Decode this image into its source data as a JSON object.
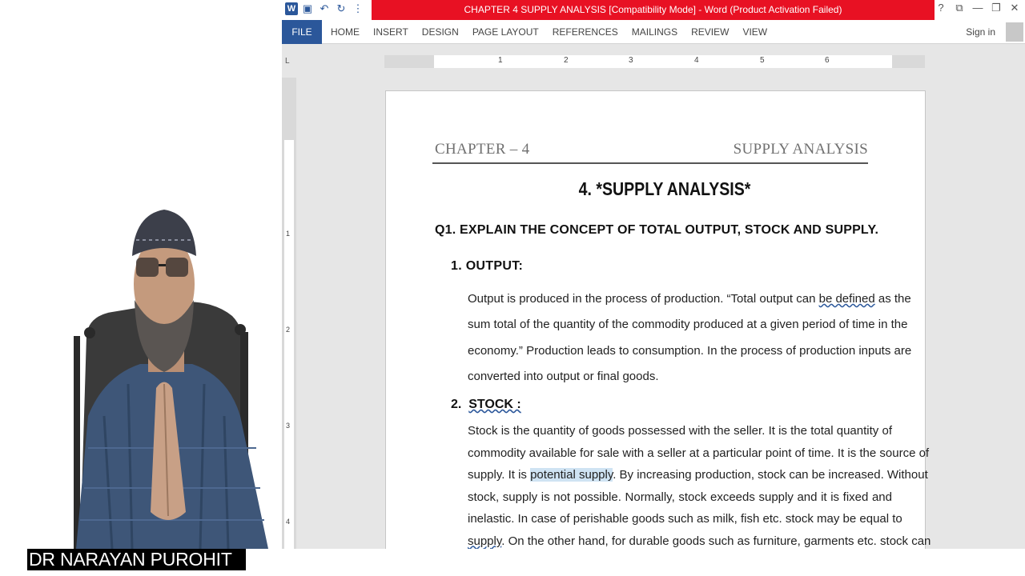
{
  "presenter": {
    "name": "DR NARAYAN PUROHIT"
  },
  "window": {
    "title": "CHAPTER 4 SUPPLY ANALYSIS [Compatibility Mode] - Word (Product Activation Failed)",
    "controls": {
      "help": "?",
      "ribbon_options": "⧉",
      "minimize": "—",
      "restore": "❐",
      "close": "✕"
    },
    "quick_access": [
      "W",
      "💾",
      "↶",
      "↻",
      "⋮"
    ]
  },
  "ribbon": {
    "file": "FILE",
    "tabs": [
      "HOME",
      "INSERT",
      "DESIGN",
      "PAGE LAYOUT",
      "REFERENCES",
      "MAILINGS",
      "REVIEW",
      "VIEW"
    ],
    "sign_in": "Sign in"
  },
  "ruler": {
    "tab_selector": "L",
    "marks": [
      "1",
      "2",
      "3",
      "4",
      "5",
      "6"
    ],
    "vertical_marks": [
      "1",
      "2",
      "3",
      "4"
    ]
  },
  "document": {
    "header_left": "CHAPTER – 4",
    "header_right": "SUPPLY ANALYSIS",
    "title": "4. *SUPPLY ANALYSIS*",
    "question": "Q1. EXPLAIN THE CONCEPT OF TOTAL OUTPUT, STOCK AND SUPPLY.",
    "section1_heading": "1.  OUTPUT:",
    "section1_lines": [
      "Output is produced in the process of production. “Total output can be  defined  as the",
      "sum total of the quantity of the commodity produced at a given period of time in the",
      "economy.” Production leads to consumption. In the process of production inputs are",
      "converted into output or final goods."
    ],
    "section2_num": "2.",
    "section2_heading": "STOCK :",
    "section2_lines": [
      "Stock is the quantity of goods possessed with the seller. It is the total quantity of",
      "commodity available for sale with a seller at a particular point of time. It is the source of",
      "supply. It is potential supply. By increasing production, stock can be increased. Without",
      "stock, supply is not possible. Normally, stock exceeds supply and it is fixed and",
      "inelastic. In case of perishable goods such as milk, fish etc. stock may be equal to",
      "supply. On the other hand, for durable goods such as furniture, garments etc. stock can"
    ],
    "highlight": "potential supply"
  }
}
